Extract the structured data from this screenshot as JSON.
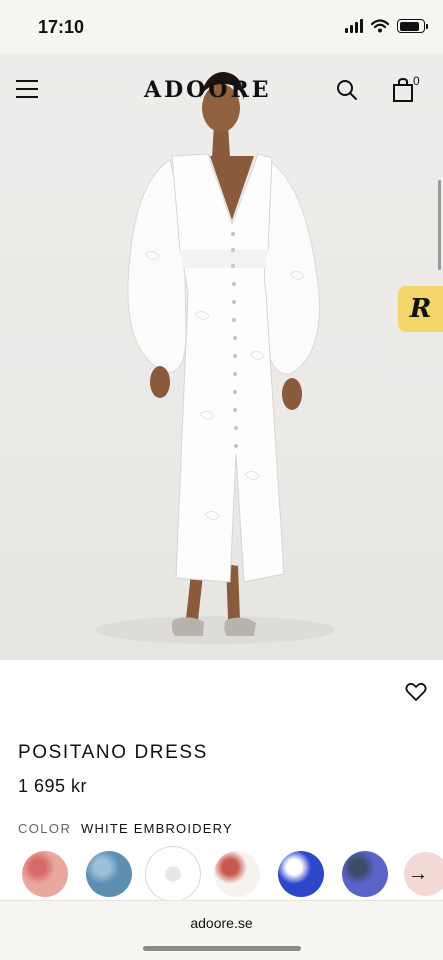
{
  "status_bar": {
    "time": "17:10",
    "battery_level": 0.85
  },
  "header": {
    "logo": "ADOORE",
    "cart_count": "0"
  },
  "product": {
    "name": "POSITANO DRESS",
    "price": "1 695 kr",
    "color_label": "COLOR",
    "color_value": "WHITE EMBROIDERY",
    "image_alt_icon": "product-photo"
  },
  "swatches": [
    {
      "name": "coral-floral",
      "base": "#e9a79f",
      "accent": "#d66a68"
    },
    {
      "name": "blue-watercolor",
      "base": "#5e8fb3",
      "accent": "#9cc0d8"
    },
    {
      "name": "white-embroidery",
      "base": "#ffffff",
      "accent": "#e7e7e7",
      "selected": true
    },
    {
      "name": "white-red-print",
      "base": "#f6f2ee",
      "accent": "#c8574f"
    },
    {
      "name": "cobalt-white-print",
      "base": "#2d47c9",
      "accent": "#ffffff"
    },
    {
      "name": "periwinkle-print",
      "base": "#5a63c8",
      "accent": "#3a4d6a"
    }
  ],
  "browser": {
    "url": "adoore.se"
  },
  "colors": {
    "accent_badge": "#f3d56a",
    "background": "#ffffff",
    "chrome": "#f6f5f2"
  }
}
